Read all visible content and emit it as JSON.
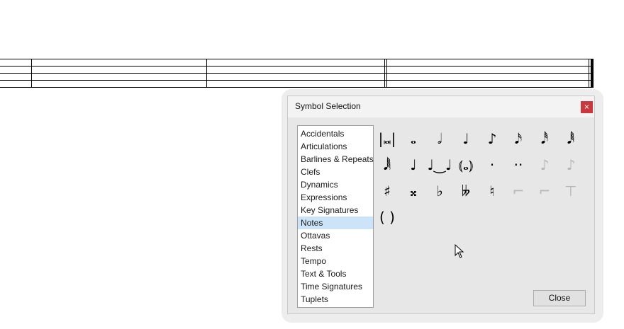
{
  "dialog": {
    "title": "Symbol Selection",
    "close_x": "×",
    "close_button": "Close"
  },
  "categories": [
    {
      "label": "Accidentals"
    },
    {
      "label": "Articulations"
    },
    {
      "label": "Barlines & Repeats"
    },
    {
      "label": "Clefs"
    },
    {
      "label": "Dynamics"
    },
    {
      "label": "Expressions"
    },
    {
      "label": "Key Signatures"
    },
    {
      "label": "Notes",
      "selected": true
    },
    {
      "label": "Ottavas"
    },
    {
      "label": "Rests"
    },
    {
      "label": "Tempo"
    },
    {
      "label": "Text & Tools"
    },
    {
      "label": "Time Signatures"
    },
    {
      "label": "Tuplets"
    }
  ],
  "symbols": [
    {
      "glyph": "|𝅜|",
      "name": "breve-note-icon"
    },
    {
      "glyph": "𝅝",
      "name": "whole-note-icon"
    },
    {
      "glyph": "𝅗𝅥",
      "name": "half-note-icon"
    },
    {
      "glyph": "♩",
      "name": "quarter-note-icon"
    },
    {
      "glyph": "♪",
      "name": "eighth-note-icon"
    },
    {
      "glyph": "𝅘𝅥𝅯",
      "name": "sixteenth-note-icon"
    },
    {
      "glyph": "𝅘𝅥𝅰",
      "name": "thirty-second-note-icon"
    },
    {
      "glyph": "𝅘𝅥𝅱",
      "name": "sixty-fourth-note-icon"
    },
    {
      "glyph": "𝅘𝅥𝅲",
      "name": "hundred-twenty-eighth-note-icon"
    },
    {
      "glyph": "♩",
      "name": "chord-icon"
    },
    {
      "glyph": "♩‿♩",
      "name": "tied-notes-icon"
    },
    {
      "glyph": "⦅𝅝⦆",
      "name": "tied-chord-icon"
    },
    {
      "glyph": "·",
      "name": "dot-icon"
    },
    {
      "glyph": "··",
      "name": "double-dot-icon"
    },
    {
      "glyph": "♪",
      "name": "grace-note-icon",
      "disabled": true
    },
    {
      "glyph": "♪",
      "name": "acciaccatura-icon",
      "disabled": true
    },
    {
      "glyph": "♯",
      "name": "sharp-icon"
    },
    {
      "glyph": "𝄪",
      "name": "double-sharp-icon"
    },
    {
      "glyph": "♭",
      "name": "flat-icon"
    },
    {
      "glyph": "𝄫",
      "name": "double-flat-icon"
    },
    {
      "glyph": "♮",
      "name": "natural-icon"
    },
    {
      "glyph": "⌐",
      "name": "flag-up-icon",
      "disabled": true
    },
    {
      "glyph": "⌐",
      "name": "flag-down-icon",
      "disabled": true
    },
    {
      "glyph": "⊤",
      "name": "beam-icon",
      "disabled": true
    },
    {
      "glyph": "( )",
      "name": "parentheses-icon"
    }
  ]
}
